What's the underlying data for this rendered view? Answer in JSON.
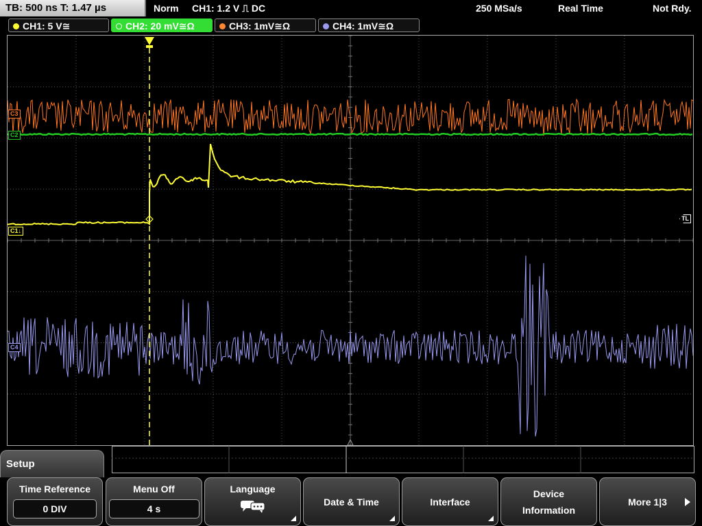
{
  "status_bar": {
    "timebase": "TB: 500 ns   T: 1.47 µs",
    "trigger_mode": "Norm",
    "trigger_info": "CH1: 1.2 V ⎍ DC",
    "sample_rate": "250 MSa/s",
    "acq_mode": "Real Time",
    "state": "Not Rdy."
  },
  "channels": [
    {
      "label": "CH1: 5 V≅",
      "color": "#ffff33",
      "active": false
    },
    {
      "label": "CH2: 20 mV≅Ω",
      "color": "#33cc33",
      "active": true
    },
    {
      "label": "CH3: 1mV≅Ω",
      "color": "#ff8833",
      "active": false
    },
    {
      "label": "CH4: 1mV≅Ω",
      "color": "#9999ee",
      "active": false
    }
  ],
  "markers": {
    "c1": "C1↓",
    "c2": "C2",
    "c3": "C3",
    "c4": "C4",
    "tl": "TL"
  },
  "colors": {
    "ch1": "#ffff33",
    "ch2": "#22cc22",
    "ch3": "#ff7722",
    "ch4": "#9999ee",
    "grid": "#555555"
  },
  "menu": {
    "title": "Setup",
    "softkeys": [
      {
        "label": "Time Reference",
        "value": "0 DIV"
      },
      {
        "label": "Menu Off",
        "value": "4 s"
      },
      {
        "label": "Language",
        "icon": "speech-bubbles-icon"
      },
      {
        "label": "Date & Time"
      },
      {
        "label": "Interface"
      },
      {
        "label_line1": "Device",
        "label_line2": "Information"
      },
      {
        "label": "More 1|3"
      }
    ]
  }
}
